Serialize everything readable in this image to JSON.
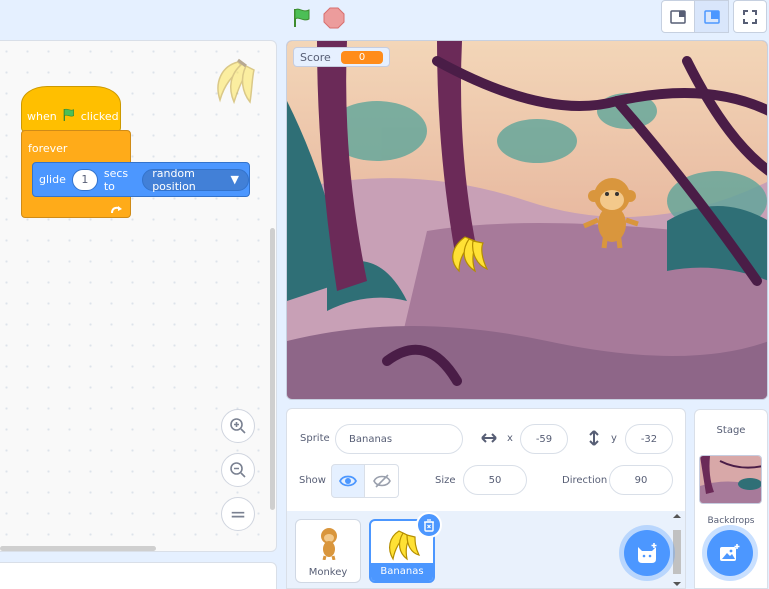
{
  "topbar": {
    "green_flag": "green-flag-icon",
    "stop": "stop-icon",
    "layout_small": "small-stage-icon",
    "layout_normal": "normal-stage-icon",
    "fullscreen": "fullscreen-icon"
  },
  "code": {
    "hat_when": "when",
    "hat_clicked": "clicked",
    "forever_label": "forever",
    "glide_label": "glide",
    "glide_secs": "1",
    "glide_secs_to": "secs to",
    "glide_target": "random position",
    "zoom_in": "zoom-in-icon",
    "zoom_out": "zoom-out-icon",
    "zoom_reset": "="
  },
  "stage": {
    "monitor_label": "Score",
    "monitor_value": "0"
  },
  "sprite_info": {
    "sprite_label": "Sprite",
    "sprite_name": "Bananas",
    "x_label": "x",
    "x_value": "-59",
    "y_label": "y",
    "y_value": "-32",
    "show_label": "Show",
    "size_label": "Size",
    "size_value": "50",
    "direction_label": "Direction",
    "direction_value": "90"
  },
  "sprites": [
    {
      "name": "Monkey",
      "selected": false
    },
    {
      "name": "Bananas",
      "selected": true
    }
  ],
  "stage_panel": {
    "title": "Stage",
    "backdrops_label": "Backdrops"
  },
  "colors": {
    "events": "#ffbf00",
    "control": "#ffab19",
    "motion": "#4c97ff",
    "monitor": "#ff8c1a"
  }
}
